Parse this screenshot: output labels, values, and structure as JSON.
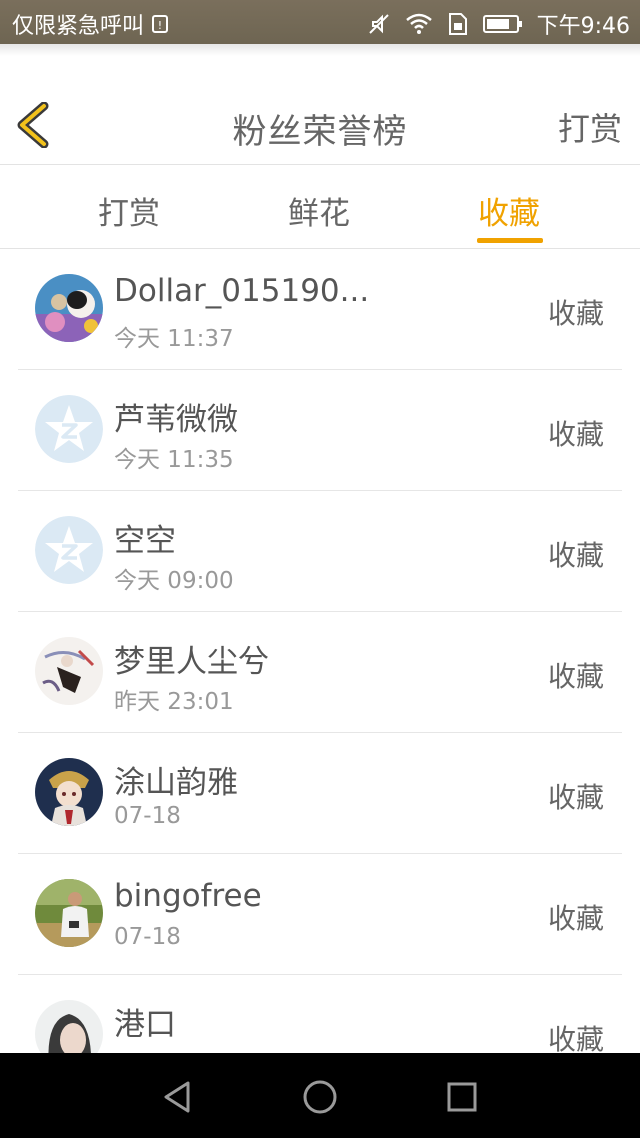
{
  "status_bar": {
    "carrier": "仅限紧急呼叫",
    "time": "下午9:46"
  },
  "header": {
    "title": "粉丝荣誉榜",
    "action": "打赏"
  },
  "tabs": [
    {
      "label": "打赏",
      "active": false
    },
    {
      "label": "鲜花",
      "active": false
    },
    {
      "label": "收藏",
      "active": true
    }
  ],
  "colors": {
    "accent": "#f0a200",
    "status_bar": "#746a57",
    "default_avatar": "#dbe9f4"
  },
  "list": [
    {
      "name": "Dollar_015190...",
      "time": "今天 11:37",
      "action": "收藏",
      "avatar": "photo-cats"
    },
    {
      "name": "芦苇微微",
      "time": "今天 11:35",
      "action": "收藏",
      "avatar": "default-qzone-star"
    },
    {
      "name": "空空",
      "time": "今天 09:00",
      "action": "收藏",
      "avatar": "default-qzone-star"
    },
    {
      "name": "梦里人尘兮",
      "time": "昨天 23:01",
      "action": "收藏",
      "avatar": "illustration-figure"
    },
    {
      "name": "涂山韵雅",
      "time": "07-18",
      "action": "收藏",
      "avatar": "illustration-girl"
    },
    {
      "name": "bingofree",
      "time": "07-18",
      "action": "收藏",
      "avatar": "photo-man-outdoor"
    },
    {
      "name": "港口",
      "time": "",
      "action": "收藏",
      "avatar": "photo-portrait"
    }
  ]
}
